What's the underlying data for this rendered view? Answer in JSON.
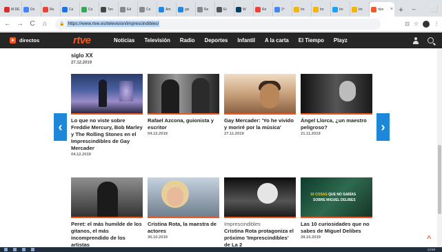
{
  "browser": {
    "tabs": [
      {
        "label": "M DE",
        "color": "#d93025"
      },
      {
        "label": "Do",
        "color": "#4285f4"
      },
      {
        "label": "Re",
        "color": "#ea4335"
      },
      {
        "label": "Ce",
        "color": "#1a73e8"
      },
      {
        "label": "Co",
        "color": "#34a853"
      },
      {
        "label": "Ten",
        "color": "#444"
      },
      {
        "label": "Ed",
        "color": "#888"
      },
      {
        "label": "Co",
        "color": "#888"
      },
      {
        "label": "Am",
        "color": "#1e88e5"
      },
      {
        "label": "gis",
        "color": "#1e88e5"
      },
      {
        "label": "Re",
        "color": "#888"
      },
      {
        "label": "Et",
        "color": "#555"
      },
      {
        "label": "W",
        "color": "#0a3d62"
      },
      {
        "label": "Re",
        "color": "#ea4335"
      },
      {
        "label": "2º",
        "color": "#4285f4"
      },
      {
        "label": "Im",
        "color": "#f4b400"
      },
      {
        "label": "Im",
        "color": "#f4b400"
      },
      {
        "label": "Im",
        "color": "#1da1f2"
      },
      {
        "label": "Im",
        "color": "#f4b400"
      }
    ],
    "active_tab": {
      "label": "rtve",
      "close": "×"
    },
    "new_tab": "+",
    "window_controls": {
      "minimize": "–",
      "maximize": "⬜",
      "close": "×"
    },
    "url": "https://www.rtve.es/television/imprescindibles/",
    "nav": {
      "back": "←",
      "forward": "→",
      "reload": "C",
      "home": "⌂"
    },
    "toolbar_icons": {
      "extension": "⊡",
      "star": "☆",
      "menu": "⋮"
    }
  },
  "rtve": {
    "directos": "directos",
    "logo": "rtve",
    "menu": [
      "Noticias",
      "Televisión",
      "Radio",
      "Deportes",
      "Infantil",
      "A la carta",
      "El Tiempo",
      "Playz"
    ]
  },
  "previous": {
    "title": "siglo XX",
    "date": "27.12.2019"
  },
  "cards": [
    {
      "title": "Lo que no viste sobre Freddie Mercury, Bob Marley y The Rolling Stones en el Imprescindibles de Gay Mercader",
      "date": "04.12.2019"
    },
    {
      "title": "Rafael Azcona, guionista y escritor",
      "date": "04.12.2019"
    },
    {
      "title": "Gay Mercader: 'Yo he vivido y moriré por la música'",
      "date": "27.11.2019"
    },
    {
      "title": "Ángel Llorca, ¿un maestro peligroso?",
      "date": "21.11.2019"
    },
    {
      "title": "Peret: el más humilde de los gitanos, el más incomprendido de los artistas",
      "date": ""
    },
    {
      "title": "Cristina Rota, la maestra de actores",
      "date": "30.10.2019"
    },
    {
      "category": "Imprescindibles",
      "title": "Cristina Rota protagoniza el próximo 'Imprescindibles' de La 2",
      "date": ""
    },
    {
      "title": "Las 10 curiosidades que no sabes de Miguel Delibes",
      "date": "28.10.2019"
    }
  ],
  "delibes_thumb": {
    "line1_num": "10 COSAS",
    "line1_rest": " QUE NO SABÍAS",
    "line2": "SOBRE MIGUEL DELIBES"
  },
  "arrows": {
    "prev": "‹",
    "next": "›"
  },
  "to_top": "^",
  "clock": "13:58",
  "colors": {
    "accent": "#f15a22",
    "nav_bg": "#262626",
    "arrow": "#1e88d8"
  }
}
